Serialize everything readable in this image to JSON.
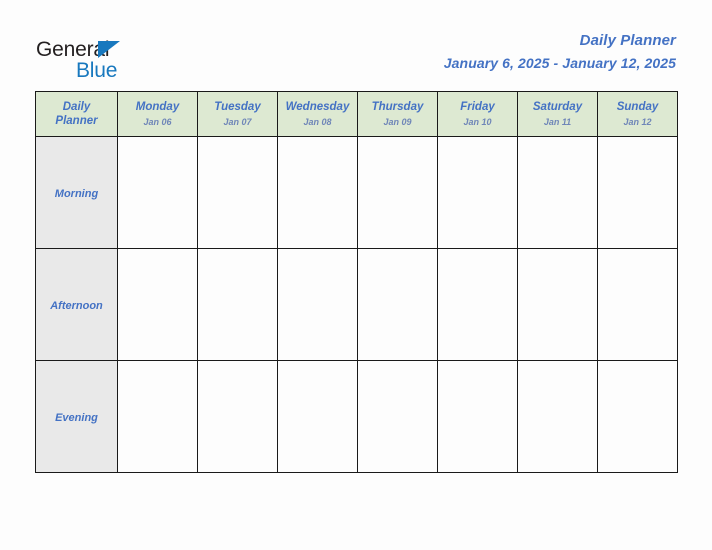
{
  "brand": {
    "name_part1": "General",
    "name_part2": "Blue",
    "logo_icon": "triangle-flag-icon",
    "accent_color": "#1878be"
  },
  "header": {
    "title": "Daily Planner",
    "date_range": "January 6, 2025 - January 12, 2025",
    "title_color": "#4472c4"
  },
  "table": {
    "corner_label_line1": "Daily",
    "corner_label_line2": "Planner",
    "header_bg_color": "#dde9d2",
    "label_bg_color": "#e9e9e9",
    "border_color": "#1a1a1a",
    "columns": [
      {
        "day": "Monday",
        "date": "Jan 06"
      },
      {
        "day": "Tuesday",
        "date": "Jan 07"
      },
      {
        "day": "Wednesday",
        "date": "Jan 08"
      },
      {
        "day": "Thursday",
        "date": "Jan 09"
      },
      {
        "day": "Friday",
        "date": "Jan 10"
      },
      {
        "day": "Saturday",
        "date": "Jan 11"
      },
      {
        "day": "Sunday",
        "date": "Jan 12"
      }
    ],
    "rows": [
      {
        "label": "Morning",
        "cells": [
          "",
          "",
          "",
          "",
          "",
          "",
          ""
        ]
      },
      {
        "label": "Afternoon",
        "cells": [
          "",
          "",
          "",
          "",
          "",
          "",
          ""
        ]
      },
      {
        "label": "Evening",
        "cells": [
          "",
          "",
          "",
          "",
          "",
          "",
          ""
        ]
      }
    ]
  }
}
